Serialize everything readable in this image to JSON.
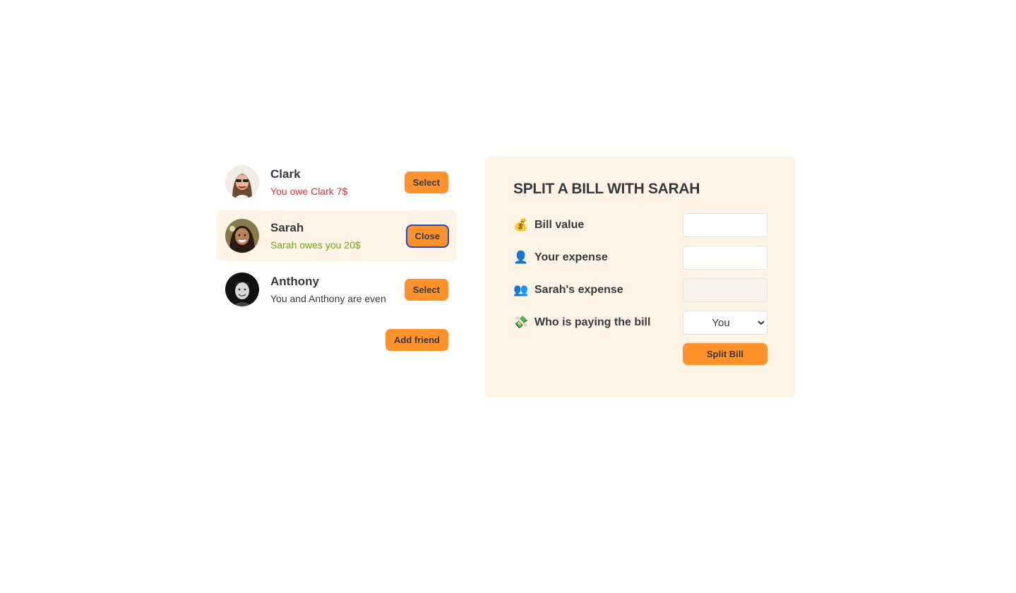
{
  "friends": [
    {
      "name": "Clark",
      "balance": "You owe Clark 7$",
      "balance_status": "negative",
      "button_label": "Select",
      "selected": false
    },
    {
      "name": "Sarah",
      "balance": "Sarah owes you 20$",
      "balance_status": "positive",
      "button_label": "Close",
      "selected": true
    },
    {
      "name": "Anthony",
      "balance": "You and Anthony are even",
      "balance_status": "even",
      "button_label": "Select",
      "selected": false
    }
  ],
  "add_friend_label": "Add friend",
  "form": {
    "title": "SPLIT A BILL WITH SARAH",
    "bill_value": {
      "icon": "money-bag-icon",
      "emoji": "💰",
      "label": "Bill value",
      "value": ""
    },
    "your_expense": {
      "icon": "user-icon",
      "emoji": "👤",
      "label": "Your expense",
      "value": ""
    },
    "friend_expense": {
      "icon": "users-icon",
      "emoji": "👥",
      "label": "Sarah's expense",
      "value": ""
    },
    "payer": {
      "icon": "money-wings-icon",
      "emoji": "💸",
      "label": "Who is paying the bill",
      "selected": "You"
    },
    "submit_label": "Split Bill"
  },
  "colors": {
    "accent": "#ff922b",
    "panel": "#fff4e6",
    "owe": "#e03131",
    "owed": "#66a80f"
  }
}
